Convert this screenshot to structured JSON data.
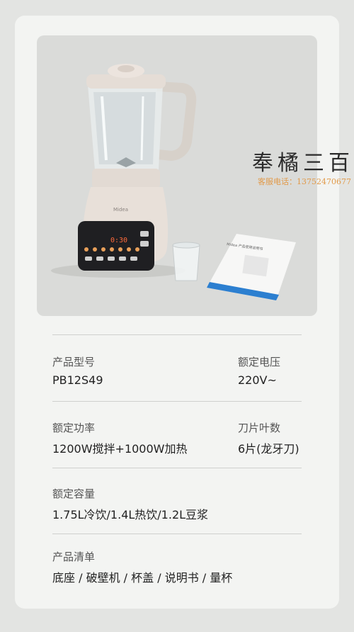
{
  "watermark": {
    "title": "奉橘三百",
    "contact": "客服电话：13752470677"
  },
  "product_image": {
    "brand_on_device": "Midea",
    "display_reading": "0:30",
    "manual_title_text": "Midea 产品使用说明书"
  },
  "specs": {
    "model": {
      "label": "产品型号",
      "value": "PB12S49"
    },
    "voltage": {
      "label": "额定电压",
      "value": "220V~"
    },
    "power": {
      "label": "额定功率",
      "value": "1200W搅拌+1000W加热"
    },
    "blades": {
      "label": "刀片叶数",
      "value": "6片(龙牙刀)"
    },
    "capacity": {
      "label": "额定容量",
      "value": "1.75L冷饮/1.4L热饮/1.2L豆浆"
    },
    "contents": {
      "label": "产品清单",
      "value": "底座 / 破壁机 / 杯盖 / 说明书 / 量杯"
    }
  },
  "colors": {
    "page_bg": "#e3e4e2",
    "card_bg": "#f3f4f2",
    "photo_bg": "#dadbd9",
    "accent_orange": "#e19a4a",
    "manual_blue": "#2c7fd0"
  }
}
